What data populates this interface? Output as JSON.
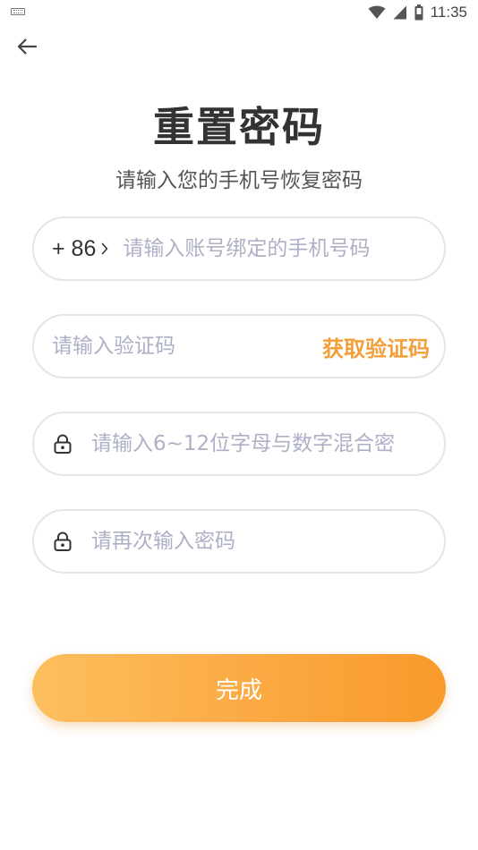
{
  "status_bar": {
    "time": "11:35",
    "left_icon": "keyboard-icon",
    "right_icons": [
      "wifi-icon",
      "signal-icon",
      "battery-icon"
    ]
  },
  "header": {
    "back_icon": "arrow-left-icon"
  },
  "page": {
    "title": "重置密码",
    "subtitle": "请输入您的手机号恢复密码"
  },
  "form": {
    "phone": {
      "country_code": "+ 86",
      "chevron_icon": "chevron-right-icon",
      "value": "",
      "placeholder": "请输入账号绑定的手机号码"
    },
    "code": {
      "value": "",
      "placeholder": "请输入验证码",
      "get_code_label": "获取验证码"
    },
    "password": {
      "icon": "lock-icon",
      "value": "",
      "placeholder": "请输入6~12位字母与数字混合密"
    },
    "confirm_password": {
      "icon": "lock-icon",
      "value": "",
      "placeholder": "请再次输入密码"
    },
    "submit_label": "完成"
  },
  "colors": {
    "accent": "#f3a03b",
    "button_gradient_start": "#fdbf5e",
    "button_gradient_end": "#f99a2c",
    "placeholder": "#aeb0c6",
    "field_border": "#e5e5e8",
    "text": "#333333"
  }
}
